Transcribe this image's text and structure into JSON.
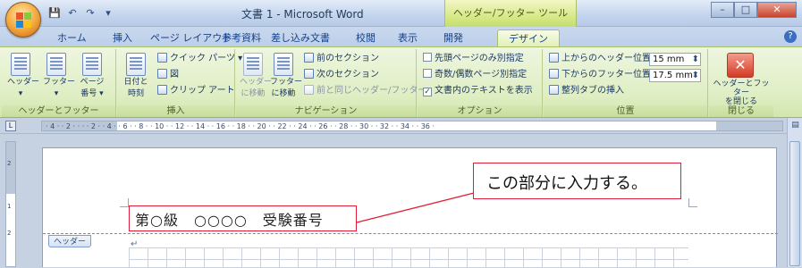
{
  "window": {
    "title": "文書 1 - Microsoft Word",
    "context_tab_group": "ヘッダー/フッター ツール",
    "buttons": {
      "minimize": "–",
      "maximize": "□",
      "close": "✕"
    }
  },
  "tabs": [
    {
      "label": "ホーム"
    },
    {
      "label": "挿入"
    },
    {
      "label": "ページ レイアウト"
    },
    {
      "label": "参考資料"
    },
    {
      "label": "差し込み文書"
    },
    {
      "label": "校閲"
    },
    {
      "label": "表示"
    },
    {
      "label": "開発"
    },
    {
      "label": "デザイン",
      "active": true
    }
  ],
  "ribbon": {
    "groups": {
      "header_footer": {
        "label": "ヘッダーとフッター",
        "header_btn": "ヘッダー",
        "footer_btn": "フッター",
        "pagenum_btn_line1": "ページ",
        "pagenum_btn_line2": "番号 ▾"
      },
      "insert": {
        "label": "挿入",
        "datetime_line1": "日付と",
        "datetime_line2": "時刻",
        "quickparts": "クイック パーツ ▾",
        "picture": "図",
        "clipart": "クリップ アート"
      },
      "navigation": {
        "label": "ナビゲーション",
        "goto_header_line1": "ヘッダー",
        "goto_header_line2": "に移動",
        "goto_footer_line1": "フッター",
        "goto_footer_line2": "に移動",
        "prev_section": "前のセクション",
        "next_section": "次のセクション",
        "link_previous": "前と同じヘッダー/フッター"
      },
      "options": {
        "label": "オプション",
        "different_first": "先頭ページのみ別指定",
        "different_odd_even": "奇数/偶数ページ別指定",
        "show_doc_text": "文書内のテキストを表示"
      },
      "position": {
        "label": "位置",
        "header_from_top": "上からのヘッダー位置:",
        "header_from_top_value": "15 mm",
        "footer_from_bottom": "下からのフッター位置:",
        "footer_from_bottom_value": "17.5 mm",
        "insert_align_tab": "整列タブの挿入"
      },
      "close": {
        "label": "閉じる",
        "close_btn_line1": "ヘッダーとフッター",
        "close_btn_line2": "を閉じる"
      }
    }
  },
  "ruler": {
    "corner": "L",
    "ticks": "· 4 ·  · 2 ·  ·   ·  · 2 ·  · 4 ·  · 6 ·  · 8 ·  · 10 ·  · 12 ·  · 14 ·  · 16 ·  · 18 ·  · 20 ·  · 22 ·  · 24 ·  · 26 ·  · 28 ·  · 30 ·  · 32 ·  · 34 ·  · 36 ·"
  },
  "vruler": {
    "marks": [
      "2",
      "1",
      "2"
    ]
  },
  "document": {
    "header_tag": "ヘッダー",
    "header_text": "第○級　○○○○　受験番号",
    "paragraph_mark": "↵",
    "callout": "この部分に入力する。"
  }
}
